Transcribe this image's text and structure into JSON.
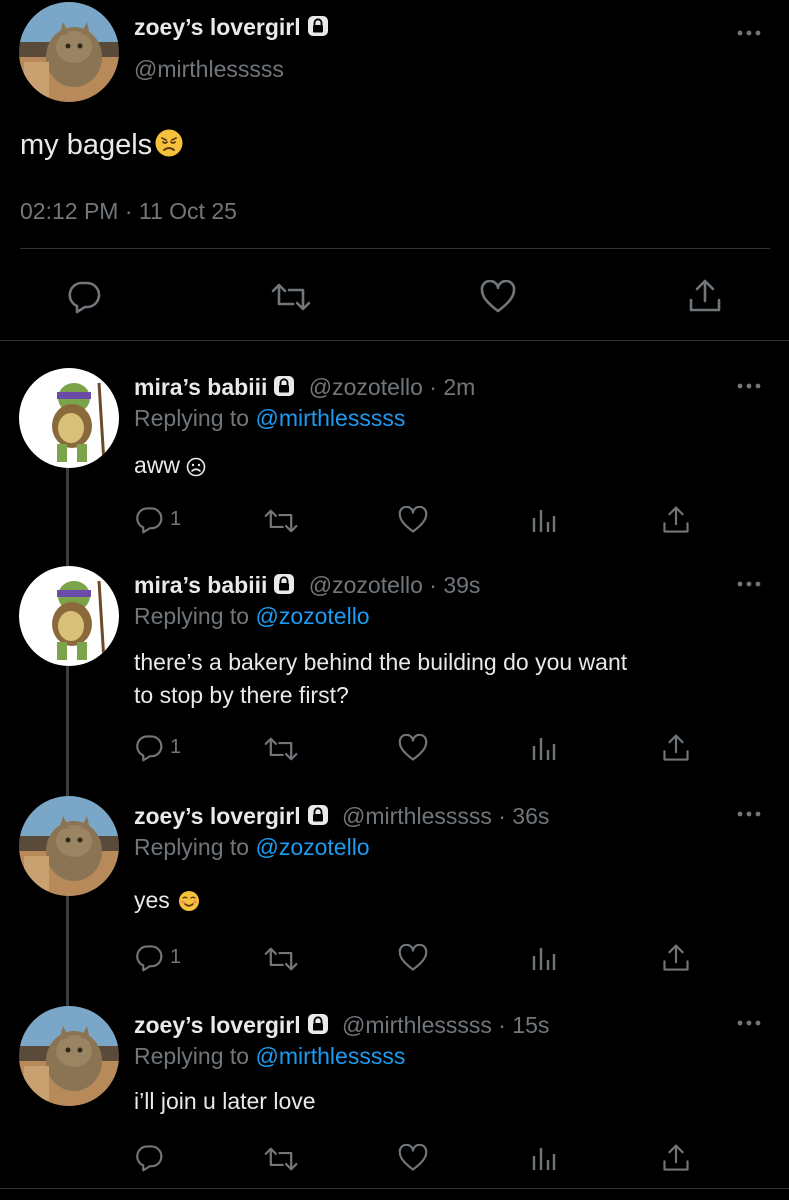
{
  "main_tweet": {
    "display_name": "zoey’s lovergirl",
    "handle": "@mirthlesssss",
    "text": "my bagels",
    "text_emoji": "disappointed-face-emoji",
    "timestamp": "02:12 PM · 11 Oct 25"
  },
  "replies": [
    {
      "display_name": "mira’s babiii",
      "meta": "@zozotello · 2m",
      "replying_prefix": "Replying to ",
      "replying_to": "@mirthlesssss",
      "text": "aww",
      "text_emoji": "frowning-face-emoji",
      "reply_count": "1"
    },
    {
      "display_name": "mira’s babiii",
      "meta": "@zozotello · 39s",
      "replying_prefix": "Replying to ",
      "replying_to": "@zozotello",
      "text_line1": "there’s a bakery behind the building do you want",
      "text_line2": "to stop by there first?",
      "reply_count": "1"
    },
    {
      "display_name": "zoey’s lovergirl",
      "meta": "@mirthlesssss · 36s",
      "replying_prefix": "Replying to ",
      "replying_to": "@zozotello",
      "text": "yes",
      "text_emoji": "smiling-face-emoji",
      "reply_count": "1"
    },
    {
      "display_name": "zoey’s lovergirl",
      "meta": "@mirthlesssss · 15s",
      "replying_prefix": "Replying to ",
      "replying_to": "@mirthlesssss",
      "text": "i’ll join u later love",
      "reply_count": ""
    }
  ],
  "colors": {
    "background": "#000000",
    "text": "#e7e9ea",
    "muted": "#71767b",
    "link": "#1d9bf0",
    "divider": "#2f3336"
  }
}
